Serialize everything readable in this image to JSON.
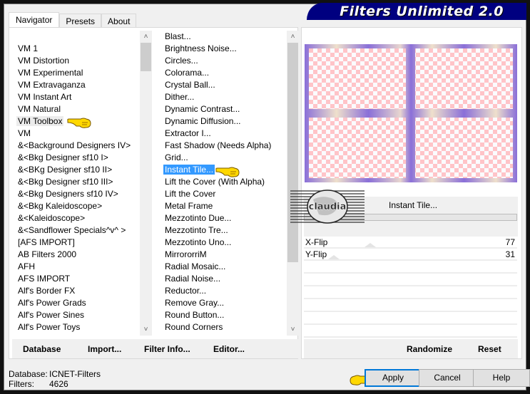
{
  "app": {
    "title": "Filters Unlimited 2.0"
  },
  "tabs": [
    {
      "label": "Navigator",
      "active": true
    },
    {
      "label": "Presets",
      "active": false
    },
    {
      "label": "About",
      "active": false
    }
  ],
  "categories": {
    "items": [
      "VM 1",
      "VM Distortion",
      "VM Experimental",
      "VM Extravaganza",
      "VM Instant Art",
      "VM Natural",
      "VM Toolbox",
      "VM",
      "&<Background Designers IV>",
      "&<Bkg Designer sf10 I>",
      "&<BKg Designer sf10 II>",
      "&<Bkg Designer sf10 III>",
      "&<Bkg Designers sf10 IV>",
      "&<Bkg Kaleidoscope>",
      "&<Kaleidoscope>",
      "&<Sandflower Specials^v^ >",
      "[AFS IMPORT]",
      "AB Filters 2000",
      "AFH",
      "AFS IMPORT",
      "Alf's Border FX",
      "Alf's Power Grads",
      "Alf's Power Sines",
      "Alf's Power Toys"
    ],
    "highlighted": "VM Toolbox",
    "scroll_position": 0.02
  },
  "filters": {
    "items": [
      "Blast...",
      "Brightness Noise...",
      "Circles...",
      "Colorama...",
      "Crystal Ball...",
      "Dither...",
      "Dynamic Contrast...",
      "Dynamic Diffusion...",
      "Extractor I...",
      "Fast Shadow (Needs Alpha)",
      "Grid...",
      "Instant Tile...",
      "Lift the Cover (With Alpha)",
      "Lift the Cover",
      "Metal Frame",
      "Mezzotinto Due...",
      "Mezzotinto Tre...",
      "Mezzotinto Uno...",
      "MirrororriM",
      "Radial Mosaic...",
      "Radial Noise...",
      "Reductor...",
      "Remove Gray...",
      "Round Button...",
      "Round Corners"
    ],
    "selected": "Instant Tile...",
    "scroll_position": 0.0
  },
  "left_buttons": {
    "database": "Database",
    "import": "Import...",
    "filter_info": "Filter Info...",
    "editor": "Editor..."
  },
  "preview": {
    "filter_name": "Instant Tile...",
    "logo_text": "claudia",
    "colors": {
      "frame": "#8a6fd8",
      "frame_highlight": "#f1e2c8",
      "checker_a": "#ffc4c8",
      "checker_b": "#fbfbff"
    }
  },
  "parameters": [
    {
      "label": "X-Flip",
      "value": 77
    },
    {
      "label": "Y-Flip",
      "value": 31
    }
  ],
  "right_buttons": {
    "randomize": "Randomize",
    "reset": "Reset"
  },
  "status": {
    "database_label": "Database:",
    "database_value": "ICNET-Filters",
    "filters_label": "Filters:",
    "filters_value": "4626"
  },
  "dialog_buttons": {
    "apply": "Apply",
    "cancel": "Cancel",
    "help": "Help"
  }
}
